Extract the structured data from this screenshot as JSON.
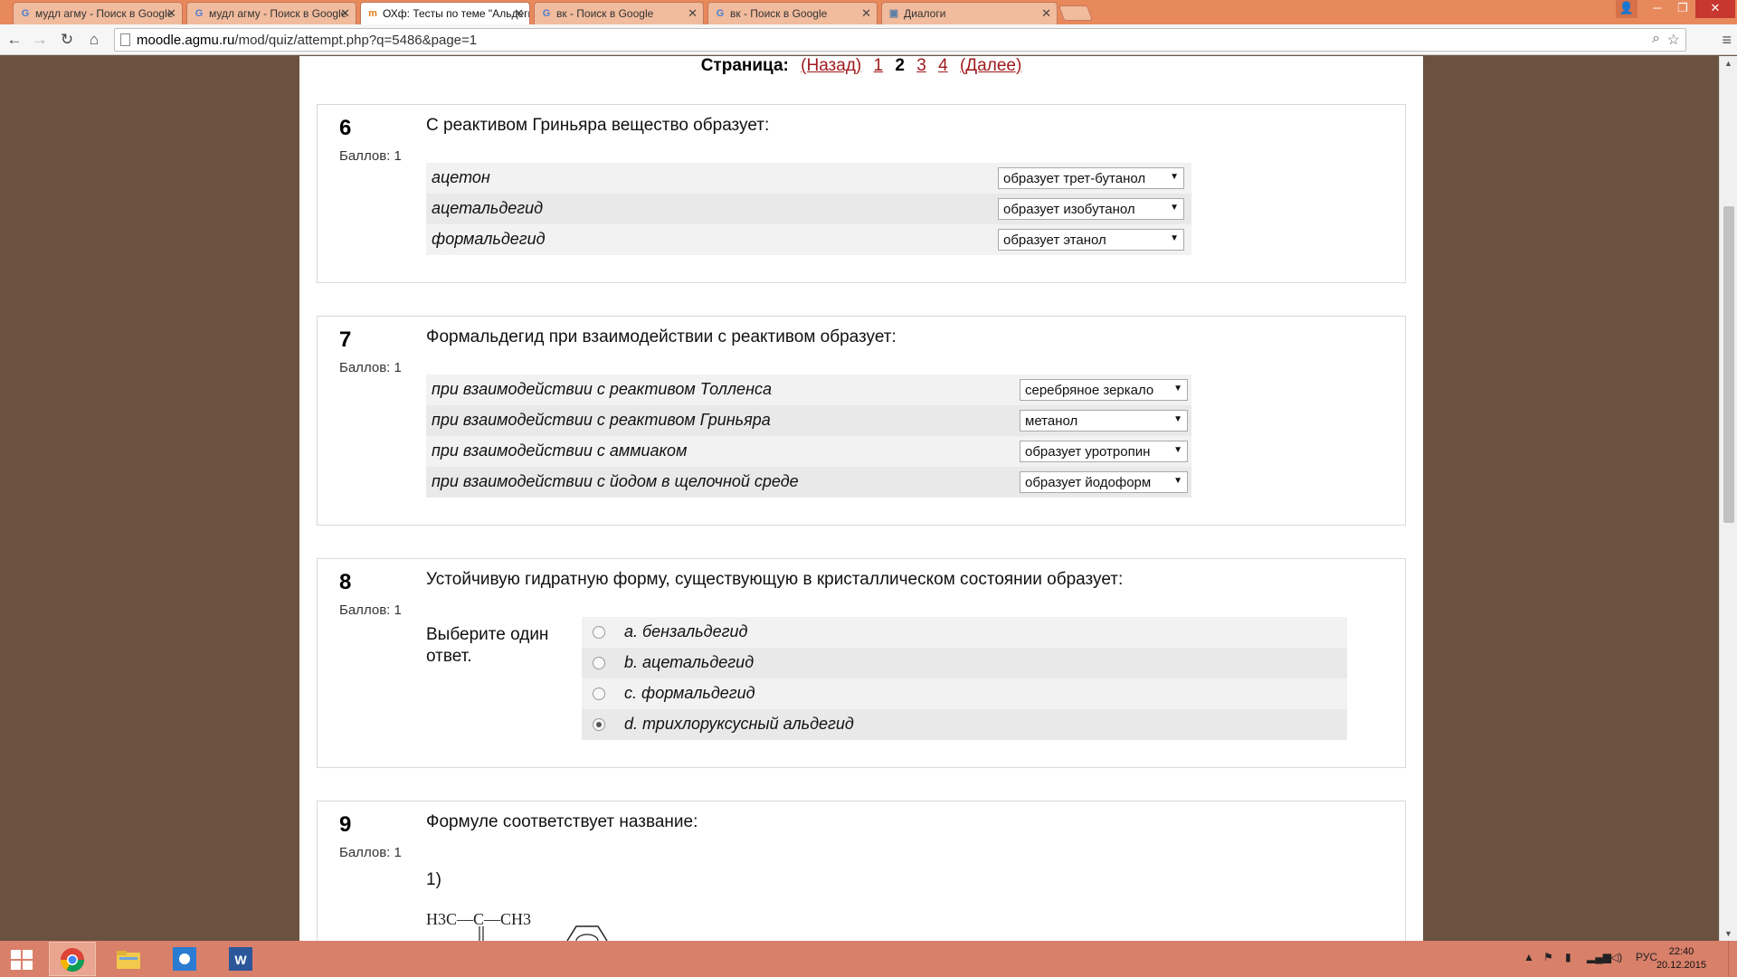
{
  "browser": {
    "tabs": [
      {
        "title": "мудл агму - Поиск в Google",
        "icon": "google-g-icon"
      },
      {
        "title": "мудл агму - Поиск в Google",
        "icon": "google-g-icon"
      },
      {
        "title": "ОХф: Тесты по теме \"Альдегиды\"",
        "icon": "moodle-icon"
      },
      {
        "title": "вк - Поиск в Google",
        "icon": "google-g-icon"
      },
      {
        "title": "вк - Поиск в Google",
        "icon": "google-g-icon"
      },
      {
        "title": "Диалоги",
        "icon": "vk-dialogs-icon"
      }
    ],
    "active_tab": 2,
    "url_host": "moodle.agmu.ru",
    "url_path": "/mod/quiz/attempt.php?q=5486&page=1"
  },
  "pager": {
    "label": "Страница:",
    "prev": "(Назад)",
    "pages": [
      "1",
      "2",
      "3",
      "4"
    ],
    "current": "2",
    "next": "(Далее)"
  },
  "questions": [
    {
      "number": "6",
      "grade": "Баллов: 1",
      "text": "С реактивом Гриньяра вещество образует:",
      "rows": [
        {
          "stem": "ацетон",
          "selected": "образует трет-бутанол"
        },
        {
          "stem": "ацетальдегид",
          "selected": "образует изобутанол"
        },
        {
          "stem": "формальдегид",
          "selected": "образует этанол"
        }
      ]
    },
    {
      "number": "7",
      "grade": "Баллов: 1",
      "text": "Формальдегид при взаимодействии с реактивом образует:",
      "rows": [
        {
          "stem": "при взаимодействии с реактивом Толленса",
          "selected": "серебряное зеркало"
        },
        {
          "stem": "при взаимодействии с реактивом Гриньяра",
          "selected": "метанол"
        },
        {
          "stem": "при взаимодействии с аммиаком",
          "selected": "образует уротропин"
        },
        {
          "stem": "при взаимодействии с йодом в щелочной среде",
          "selected": "образует йодоформ"
        }
      ]
    },
    {
      "number": "8",
      "grade": "Баллов: 1",
      "text": "Устойчивую гидратную форму, существующую в кристаллическом состоянии образует:",
      "prompt_line1": "Выберите один",
      "prompt_line2": "ответ.",
      "answers": [
        {
          "label": "a. бензальдегид",
          "checked": false
        },
        {
          "label": "b. ацетальдегид",
          "checked": false
        },
        {
          "label": "c. формальдегид",
          "checked": false
        },
        {
          "label": "d. трихлоруксусный альдегид",
          "checked": true
        }
      ]
    },
    {
      "number": "9",
      "grade": "Баллов: 1",
      "text": "Формуле соответствует название:",
      "sub": "1)",
      "formula": "H3C—C—CH3"
    }
  ],
  "taskbar": {
    "apps": [
      "chrome-icon",
      "file-explorer-icon",
      "weather-icon",
      "word-icon"
    ],
    "language": "РУС",
    "time": "22:40",
    "date": "20.12.2015"
  }
}
